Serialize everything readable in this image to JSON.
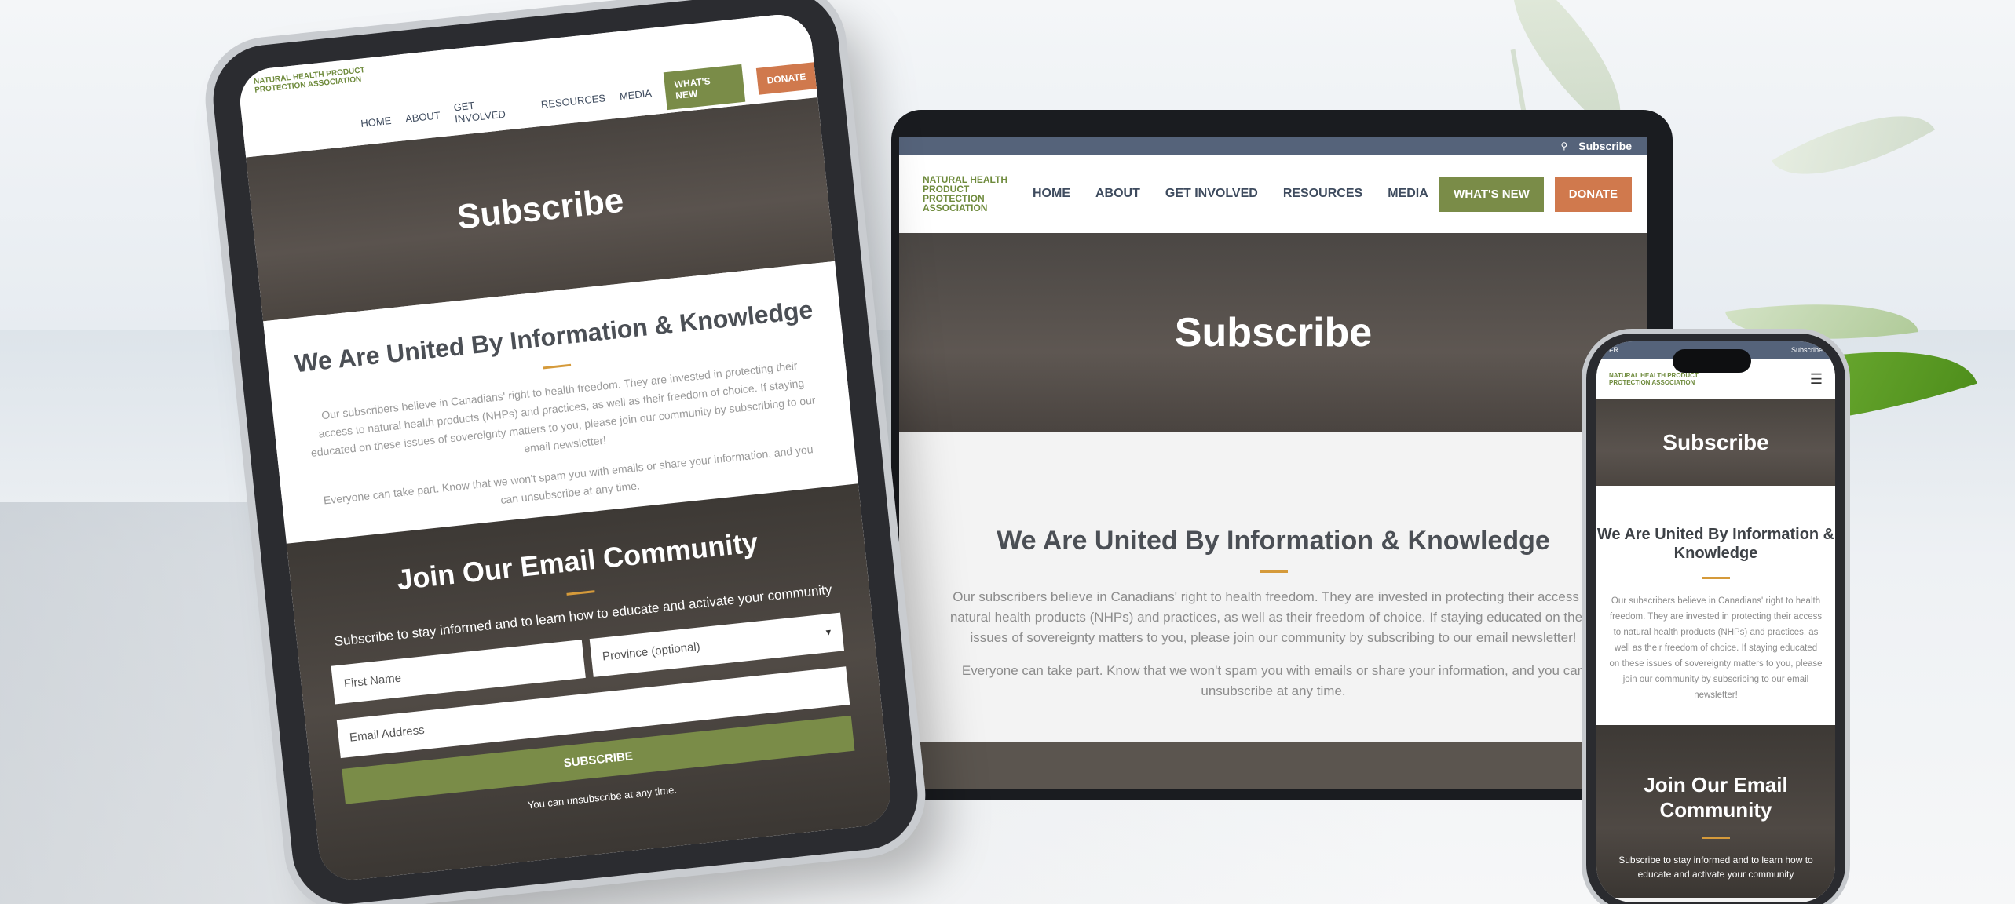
{
  "site": {
    "logo_text": "NATURAL HEALTH PRODUCT PROTECTION ASSOCIATION"
  },
  "nav": {
    "home": "HOME",
    "about": "ABOUT",
    "get_involved": "GET INVOLVED",
    "resources": "RESOURCES",
    "media": "MEDIA",
    "whats_new": "WHAT'S NEW",
    "donate": "DONATE"
  },
  "topbar": {
    "subscribe": "Subscribe",
    "language": "FR"
  },
  "hero": {
    "title": "Subscribe"
  },
  "info": {
    "heading": "We Are United By Information & Knowledge",
    "para1": "Our subscribers believe in Canadians' right to health freedom. They are invested in protecting their access to natural health products (NHPs) and practices, as well as their freedom of choice. If staying educated on these issues of sovereignty matters to you, please join our community by subscribing to our email newsletter!",
    "para2": "Everyone can take part. Know that we won't spam you with emails or share your information, and you can unsubscribe at any time."
  },
  "join": {
    "heading": "Join Our Email Community",
    "subtitle": "Subscribe to stay informed and to learn how to educate and activate your community",
    "first_name_placeholder": "First Name",
    "province_placeholder": "Province (optional)",
    "email_placeholder": "Email Address",
    "subscribe_button": "SUBSCRIBE",
    "note": "You can unsubscribe at any time."
  },
  "colors": {
    "primary_green": "#7a8c48",
    "accent_orange": "#d0794d",
    "topbar_blue": "#55637a",
    "divider_gold": "#d59a3a"
  }
}
